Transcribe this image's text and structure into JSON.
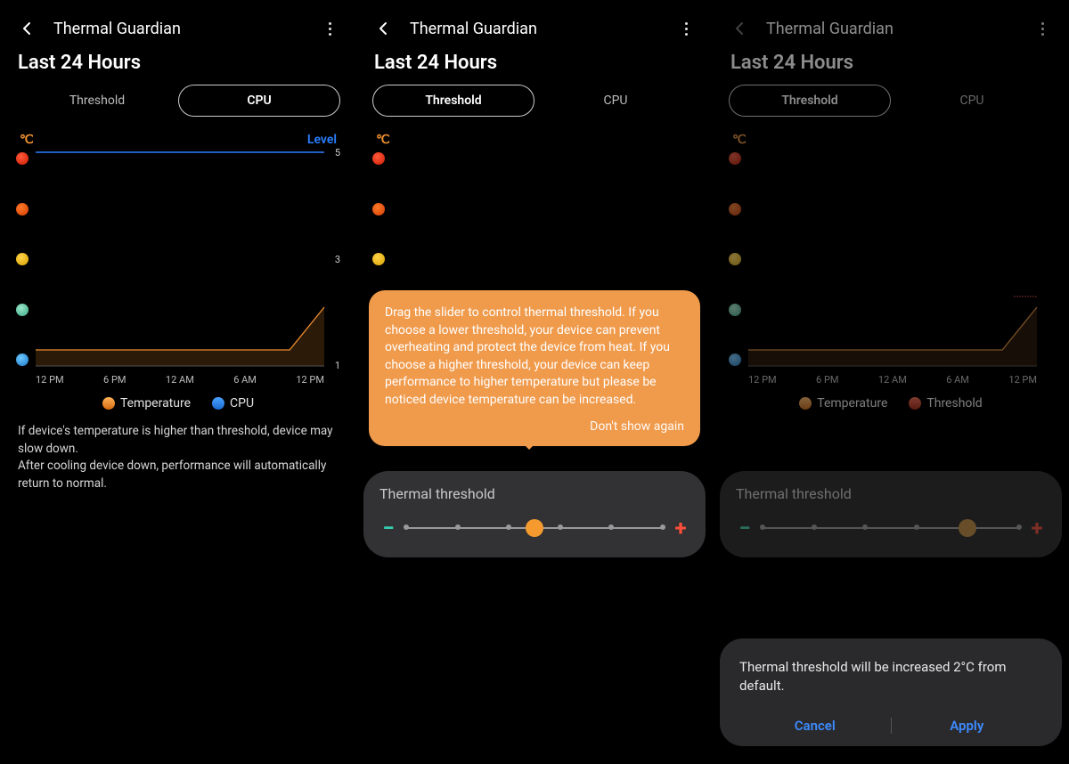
{
  "app_title": "Thermal Guardian",
  "section_title": "Last 24 Hours",
  "tabs": {
    "threshold": "Threshold",
    "cpu": "CPU"
  },
  "axis": {
    "c": "℃",
    "level": "Level"
  },
  "yticks": {
    "t5": "5",
    "t3": "3",
    "t1": "1"
  },
  "xticks": [
    "12 PM",
    "6 PM",
    "12 AM",
    "6 AM",
    "12 PM"
  ],
  "legend": {
    "temp": "Temperature",
    "cpu": "CPU",
    "thr": "Threshold"
  },
  "desc1": "If device's temperature is higher than threshold, device may slow down.\nAfter cooling device down, performance will automatically return to normal.",
  "slider_title": "Thermal threshold",
  "tooltip_text": "Drag the slider to control thermal threshold. If you choose a lower threshold, your device can prevent overheating and protect the device from heat. If you choose a higher threshold, your device can keep performance to higher temperature but please be noticed device temperature can be increased.",
  "tooltip_link": "Don't show again",
  "dialog_msg": "Thermal threshold will be increased 2°C from default.",
  "dialog_cancel": "Cancel",
  "dialog_apply": "Apply",
  "screens": [
    {
      "active_tab": "cpu",
      "show_level": true,
      "show_yticks": true,
      "show_cpu_line": true,
      "show_threshold_marks": false,
      "slider": false,
      "tooltip": false,
      "dialog": false,
      "dimmed": false,
      "legend2": "cpu",
      "knob_pos": 50
    },
    {
      "active_tab": "threshold",
      "show_level": false,
      "show_yticks": false,
      "show_cpu_line": false,
      "show_threshold_marks": true,
      "slider": true,
      "tooltip": true,
      "dialog": false,
      "dimmed": false,
      "legend2": "thr",
      "knob_pos": 50
    },
    {
      "active_tab": "threshold",
      "show_level": false,
      "show_yticks": false,
      "show_cpu_line": false,
      "show_threshold_marks": true,
      "slider": true,
      "tooltip": false,
      "dialog": true,
      "dimmed": true,
      "legend2": "thr",
      "knob_pos": 80
    }
  ],
  "chart_data": {
    "type": "line",
    "x": [
      "12 PM",
      "6 PM",
      "12 AM",
      "6 AM",
      "10 AM",
      "12 PM"
    ],
    "xlabel": "",
    "ylabel_left": "℃",
    "ylabel_right": "Level",
    "ylim_right": [
      1,
      5
    ],
    "series": [
      {
        "name": "Temperature",
        "axis": "left",
        "color": "#f09030",
        "values_level_est": [
          1.3,
          1.3,
          1.3,
          1.3,
          1.3,
          2.1
        ]
      },
      {
        "name": "CPU",
        "axis": "right",
        "color": "#2b7fff",
        "values_level": [
          5,
          5,
          5,
          5,
          5,
          5
        ]
      },
      {
        "name": "Threshold",
        "axis": "left",
        "color": "#ff4d3a",
        "style": "dashed-marker",
        "values_level_est": [
          null,
          null,
          null,
          null,
          null,
          2.3
        ]
      }
    ],
    "right_ticks": [
      5,
      3,
      1
    ],
    "emoji_scale": [
      "hot",
      "warm",
      "neutral",
      "cool",
      "cold"
    ]
  }
}
